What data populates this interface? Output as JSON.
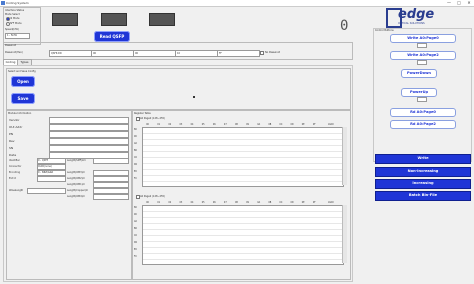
{
  "window": {
    "title": "Coding System",
    "minimize": "—",
    "maximize": "□",
    "close": "✕"
  },
  "top": {
    "interface_group": "Interface Status",
    "radio_label": "Mode Select",
    "radio_1": "I2 Mode",
    "radio_2": "SFF Mode",
    "speed_label": "Speed(kHz)",
    "speed_value": "1 - 5kHz",
    "read_button": "Read QSFP",
    "status_digit": "0"
  },
  "logo": {
    "name": "edge",
    "sub": "OPTICAL SOLUTIONS"
  },
  "password": {
    "label": "Password",
    "field_label": "Password(Hex)",
    "select_value": "QSFP-DD",
    "fields": [
      "00",
      "00",
      "10",
      "FF"
    ],
    "checkbox_label": "No Password"
  },
  "tabs": [
    "Coding",
    "Types"
  ],
  "file_group": {
    "label": "Select and Save Config",
    "open": "Open",
    "save": "Save"
  },
  "module_info": {
    "label": "Module Information",
    "fields": [
      "Vendor",
      "OUI Addr",
      "PN",
      "Rev",
      "SN",
      "Date"
    ],
    "left_rows": [
      {
        "label": "Identifier",
        "value": "0 - QSFP"
      },
      {
        "label": "Connector",
        "value": "0x00(none)"
      },
      {
        "label": "Encoding",
        "value": "0 - NRZ/G&R"
      },
      {
        "label": "Ext Id",
        "value": ""
      },
      {
        "label": "Wavelength",
        "value": ""
      }
    ],
    "right_rows": [
      {
        "label": "Length(SMF)km"
      },
      {
        "label": "Length(OM3)m"
      },
      {
        "label": "Length(OM2)m"
      },
      {
        "label": "Length(OM1)m"
      },
      {
        "label": "Length(Copper)m"
      },
      {
        "label": "Length(OM4)m"
      }
    ]
  },
  "register": {
    "label": "Register Table",
    "table1_title": "A0 Page0 (128~255)",
    "table2_title": "A0 Page2 (128~255)",
    "col_headers": [
      "00",
      "01",
      "02",
      "03",
      "04",
      "05",
      "06",
      "07",
      "08",
      "09",
      "0A",
      "0B",
      "0C",
      "0D",
      "0E",
      "0F",
      "ASCII"
    ],
    "row_headers": [
      "80",
      "90",
      "A0",
      "B0",
      "C0",
      "D0",
      "E0",
      "F0"
    ]
  },
  "sidebar": {
    "label": "Control Buttons",
    "write_page0": "Write A0:Page0",
    "write_page2": "Write A0:Page2",
    "power_down": "PowerDown",
    "power_up": "PowerUp",
    "read_page0": "Rd A0:Page0",
    "read_page2": "Rd A0:Page2",
    "write": "Write",
    "non_increasing": "Non-Increasing",
    "increasing": "Increasing",
    "batch": "Batch Bin-File"
  },
  "colors": {
    "accent": "#1f35d6",
    "background": "#f0f0f0"
  }
}
